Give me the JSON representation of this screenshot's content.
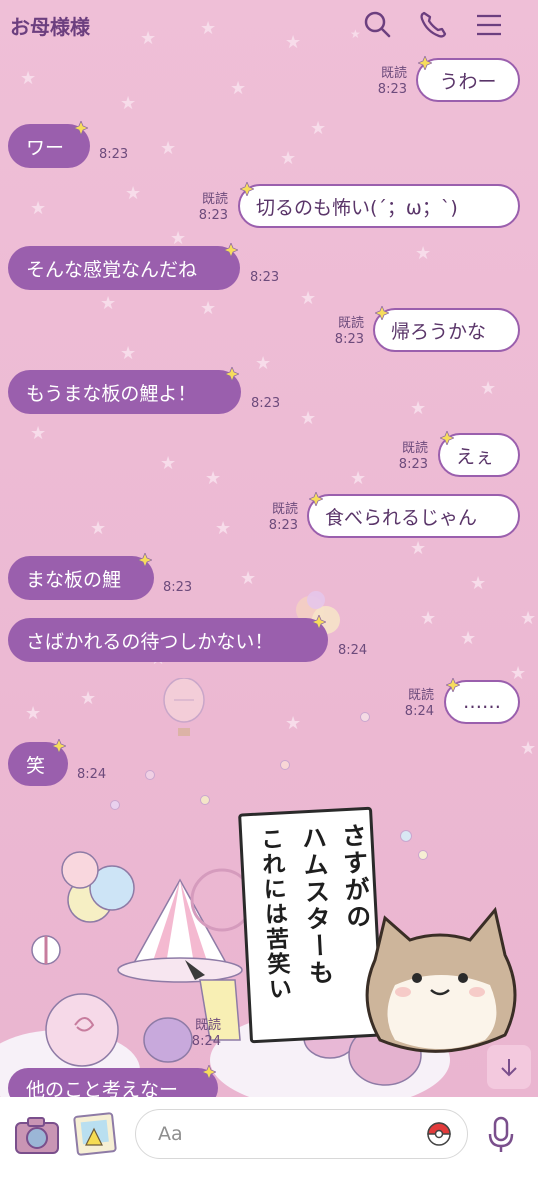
{
  "header": {
    "title": "お母様様",
    "search_icon": "search-icon",
    "call_icon": "phone-icon",
    "menu_icon": "hamburger-menu-icon"
  },
  "colors": {
    "background": "#ebb9d3",
    "incoming_bubble": "#9a5fad",
    "outgoing_border": "#9a5fad",
    "title": "#6c3f7f"
  },
  "messages": [
    {
      "dir": "out",
      "text": "うわー",
      "read": "既読",
      "time": "8:23"
    },
    {
      "dir": "in",
      "text": "ワー",
      "time": "8:23"
    },
    {
      "dir": "out",
      "text": "切るのも怖い(´；ω；`)",
      "read": "既読",
      "time": "8:23"
    },
    {
      "dir": "in",
      "text": "そんな感覚なんだね",
      "time": "8:23"
    },
    {
      "dir": "out",
      "text": "帰ろうかな",
      "read": "既読",
      "time": "8:23"
    },
    {
      "dir": "in",
      "text": "もうまな板の鯉よ！",
      "time": "8:23"
    },
    {
      "dir": "out",
      "text": "えぇ",
      "read": "既読",
      "time": "8:23"
    },
    {
      "dir": "out",
      "text": "食べられるじゃん",
      "read": "既読",
      "time": "8:23"
    },
    {
      "dir": "in",
      "text": "まな板の鯉",
      "time": "8:23"
    },
    {
      "dir": "in",
      "text": "さばかれるの待つしかない！",
      "time": "8:24"
    },
    {
      "dir": "out",
      "text": "……",
      "read": "既読",
      "time": "8:24"
    },
    {
      "dir": "in",
      "text": "笑",
      "time": "8:24"
    },
    {
      "dir": "in",
      "text": "他のこと考えなー",
      "time": ""
    }
  ],
  "sticker": {
    "name": "hamster-sticker",
    "lines": [
      "さすがの",
      "ハムスターも",
      "これには苦笑い"
    ],
    "read": "既読",
    "time": "8:24"
  },
  "input_bar": {
    "placeholder": "Aa",
    "camera_icon": "camera-icon",
    "gallery_icon": "gallery-icon",
    "emoji_icon": "pokeball-emoji-icon",
    "mic_icon": "microphone-icon"
  },
  "scroll_button_icon": "arrow-down-icon"
}
